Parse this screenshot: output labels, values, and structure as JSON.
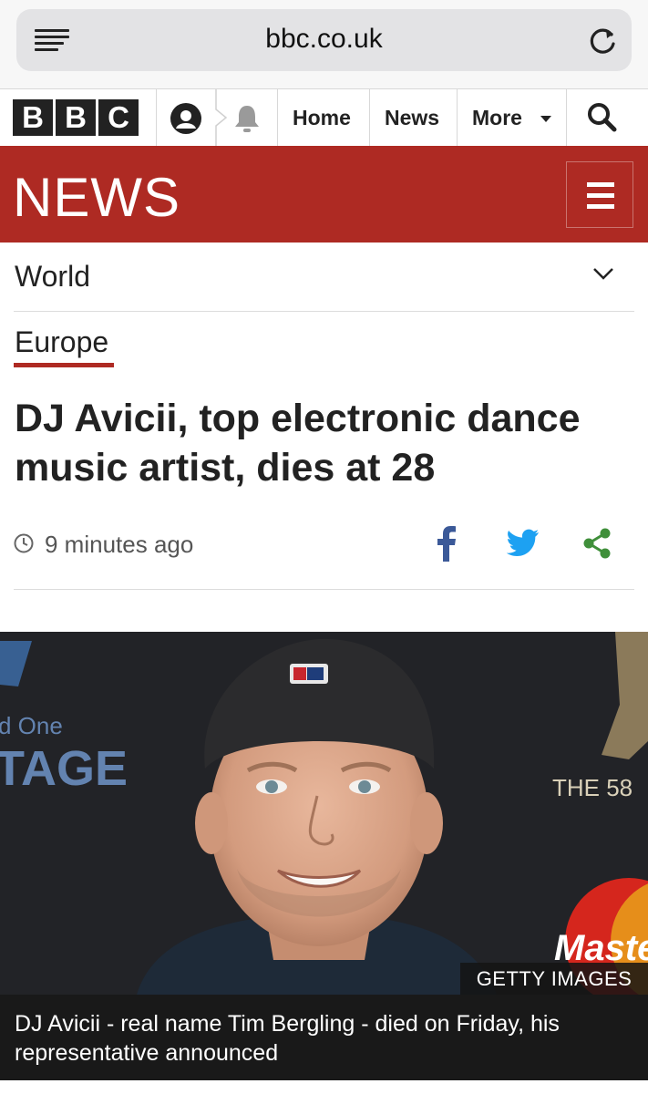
{
  "browser": {
    "url": "bbc.co.uk"
  },
  "bbc_nav": {
    "logo_letters": [
      "B",
      "B",
      "C"
    ],
    "items": [
      {
        "label": "Home"
      },
      {
        "label": "News"
      },
      {
        "label": "More"
      }
    ]
  },
  "banner": {
    "wordmark": "NEWS",
    "color": "#ae2a23"
  },
  "section": {
    "label": "World"
  },
  "subsection": {
    "label": "Europe"
  },
  "article": {
    "headline": "DJ Avicii, top electronic dance music artist, dies at 28",
    "timestamp": "9 minutes ago",
    "share": {
      "facebook_color": "#3b5998",
      "twitter_color": "#1da1f2",
      "share_color": "#3f8f3a"
    },
    "image": {
      "credit": "GETTY IMAGES",
      "caption": "DJ Avicii - real name Tim Bergling - died on Friday, his representative announced",
      "backdrop_text": {
        "left_small": "d One",
        "left_big": "TAGE",
        "right": "THE 58",
        "sponsor": "Maste"
      }
    }
  }
}
